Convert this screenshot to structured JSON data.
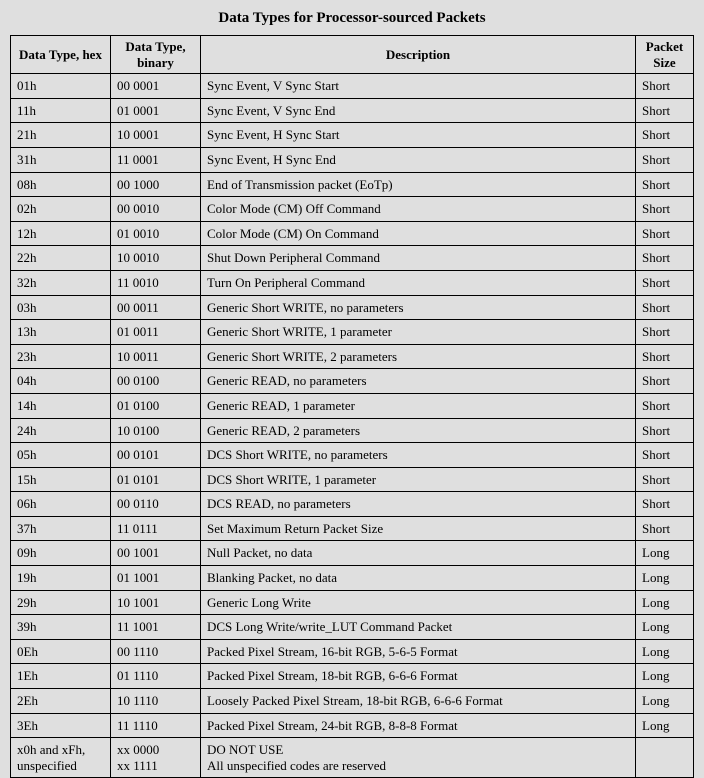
{
  "title": "Data Types for Processor-sourced Packets",
  "headers": {
    "hex": "Data Type, hex",
    "bin": "Data Type, binary",
    "desc": "Description",
    "size": "Packet Size"
  },
  "rows": [
    {
      "hex": "01h",
      "bin": "00 0001",
      "desc": "Sync Event, V Sync Start",
      "size": "Short"
    },
    {
      "hex": "11h",
      "bin": "01 0001",
      "desc": "Sync Event, V Sync End",
      "size": "Short"
    },
    {
      "hex": "21h",
      "bin": "10 0001",
      "desc": "Sync Event, H Sync Start",
      "size": "Short"
    },
    {
      "hex": "31h",
      "bin": "11 0001",
      "desc": "Sync Event, H Sync End",
      "size": "Short"
    },
    {
      "hex": "08h",
      "bin": "00 1000",
      "desc": "End of Transmission packet (EoTp)",
      "size": "Short"
    },
    {
      "hex": "02h",
      "bin": "00 0010",
      "desc": "Color Mode (CM) Off Command",
      "size": "Short"
    },
    {
      "hex": "12h",
      "bin": "01 0010",
      "desc": "Color Mode (CM) On Command",
      "size": "Short"
    },
    {
      "hex": "22h",
      "bin": "10 0010",
      "desc": "Shut Down Peripheral Command",
      "size": "Short"
    },
    {
      "hex": "32h",
      "bin": "11 0010",
      "desc": "Turn On Peripheral Command",
      "size": "Short"
    },
    {
      "hex": "03h",
      "bin": "00 0011",
      "desc": "Generic Short WRITE, no parameters",
      "size": "Short"
    },
    {
      "hex": "13h",
      "bin": "01 0011",
      "desc": "Generic Short WRITE, 1 parameter",
      "size": "Short"
    },
    {
      "hex": "23h",
      "bin": "10 0011",
      "desc": "Generic Short WRITE, 2 parameters",
      "size": "Short"
    },
    {
      "hex": "04h",
      "bin": "00 0100",
      "desc": "Generic READ, no parameters",
      "size": "Short"
    },
    {
      "hex": "14h",
      "bin": "01 0100",
      "desc": "Generic READ, 1 parameter",
      "size": "Short"
    },
    {
      "hex": "24h",
      "bin": "10 0100",
      "desc": "Generic READ, 2 parameters",
      "size": "Short"
    },
    {
      "hex": "05h",
      "bin": "00 0101",
      "desc": "DCS Short WRITE, no parameters",
      "size": "Short"
    },
    {
      "hex": "15h",
      "bin": "01 0101",
      "desc": "DCS Short WRITE, 1 parameter",
      "size": "Short"
    },
    {
      "hex": "06h",
      "bin": "00 0110",
      "desc": "DCS READ, no parameters",
      "size": "Short"
    },
    {
      "hex": "37h",
      "bin": "11 0111",
      "desc": "Set Maximum Return Packet Size",
      "size": "Short"
    },
    {
      "hex": "09h",
      "bin": "00 1001",
      "desc": "Null Packet, no data",
      "size": "Long"
    },
    {
      "hex": "19h",
      "bin": "01 1001",
      "desc": "Blanking Packet, no data",
      "size": "Long"
    },
    {
      "hex": "29h",
      "bin": "10 1001",
      "desc": "Generic Long Write",
      "size": "Long"
    },
    {
      "hex": "39h",
      "bin": "11 1001",
      "desc": "DCS Long Write/write_LUT Command Packet",
      "size": "Long"
    },
    {
      "hex": "0Eh",
      "bin": "00 1110",
      "desc": "Packed Pixel Stream, 16-bit RGB, 5-6-5 Format",
      "size": "Long"
    },
    {
      "hex": "1Eh",
      "bin": "01 1110",
      "desc": "Packed Pixel Stream, 18-bit RGB, 6-6-6 Format",
      "size": "Long"
    },
    {
      "hex": "2Eh",
      "bin": "10 1110",
      "desc": "Loosely Packed Pixel Stream, 18-bit RGB, 6-6-6 Format",
      "size": "Long"
    },
    {
      "hex": "3Eh",
      "bin": "11 1110",
      "desc": "Packed Pixel Stream, 24-bit RGB, 8-8-8 Format",
      "size": "Long"
    }
  ],
  "reserved": {
    "hex": "x0h and xFh, unspecified",
    "bin": "xx 0000\nxx 1111",
    "desc": "DO NOT USE\nAll unspecified codes are reserved",
    "size": ""
  }
}
